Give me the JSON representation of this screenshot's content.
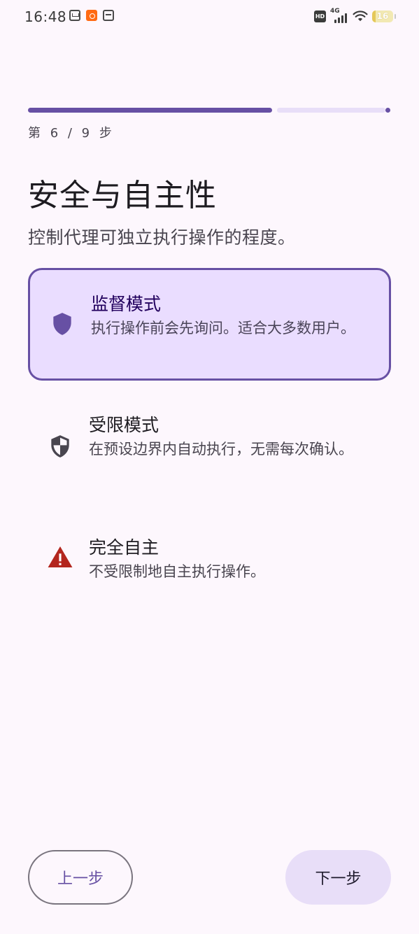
{
  "status_bar": {
    "time": "16:48",
    "hd_label": "HD",
    "network_label": "4G",
    "battery_level": "16",
    "battery_fraction": 0.16
  },
  "progress": {
    "current_step": 6,
    "total_steps": 9,
    "label": "第 6 / 9 步",
    "color_active": "#6750a4",
    "color_inactive": "#e8def8"
  },
  "page": {
    "title": "安全与自主性",
    "subtitle": "控制代理可独立执行操作的程度。"
  },
  "options": [
    {
      "title": "监督模式",
      "description": "执行操作前会先询问。适合大多数用户。",
      "icon": "shield-icon",
      "icon_color": "#6750a4",
      "selected": true
    },
    {
      "title": "受限模式",
      "description": "在预设边界内自动执行，无需每次确认。",
      "icon": "shield-half-icon",
      "icon_color": "#49454f",
      "selected": false
    },
    {
      "title": "完全自主",
      "description": "不受限制地自主执行操作。",
      "icon": "warning-icon",
      "icon_color": "#b3261e",
      "selected": false
    }
  ],
  "buttons": {
    "back_label": "上一步",
    "next_label": "下一步"
  }
}
